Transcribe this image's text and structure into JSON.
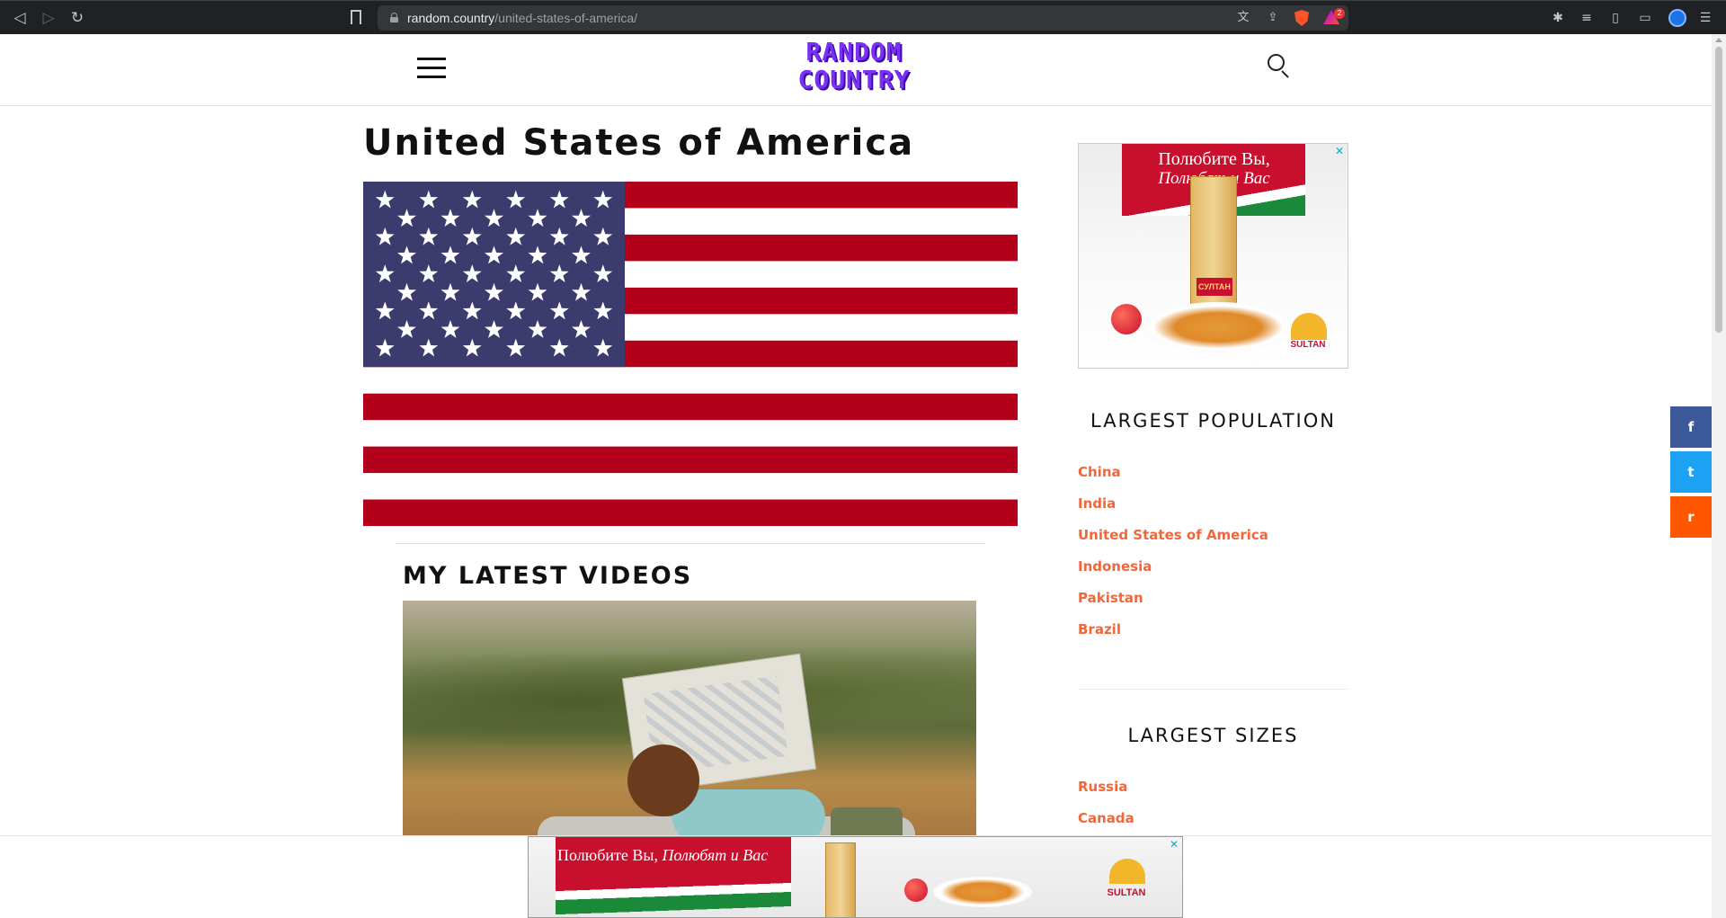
{
  "browser": {
    "url_host": "random.country",
    "url_path": "/united-states-of-america/",
    "rewards_count": "2",
    "icons": {
      "back": "back-icon",
      "forward": "forward-icon",
      "reload": "reload-icon",
      "bookmark": "bookmark-icon",
      "translate": "translate-icon",
      "share": "share-icon",
      "extensions": "puzzle-icon",
      "menu": "menu-icon"
    }
  },
  "site": {
    "logo_line1": "RANDOM",
    "logo_line2": "COUNTRY",
    "accent_color": "#f0673c",
    "logo_color": "#7b2ff7"
  },
  "main": {
    "title": "United States of America",
    "videos_heading": "MY LATEST VIDEOS",
    "share_icon": "f"
  },
  "flag": {
    "stripe_red": "#b3001b",
    "stripe_white": "#ffffff",
    "canton_blue": "#3c3b6e",
    "stripes": 13,
    "stars": 50
  },
  "sidebar": {
    "ad_text_1": "Полюбите Вы,",
    "ad_text_2": "Полюбят и Вас",
    "ad_brand": "SULTAN",
    "ad_pack_label": "СУЛТАН",
    "population_title": "LARGEST POPULATION",
    "population": [
      "China",
      "India",
      "United States of America",
      "Indonesia",
      "Pakistan",
      "Brazil"
    ],
    "sizes_title": "LARGEST SIZES",
    "sizes": [
      "Russia",
      "Canada"
    ]
  },
  "floating_share": {
    "facebook": "f",
    "twitter": "t",
    "reddit": "r",
    "facebook_color": "#3b5998",
    "twitter_color": "#1da1f2",
    "reddit_color": "#ff5700"
  },
  "bottom_ad": {
    "text_plain": "Полюбите Вы, ",
    "text_italic": "Полюбят и Вас",
    "brand": "SULTAN",
    "close": "✕"
  }
}
